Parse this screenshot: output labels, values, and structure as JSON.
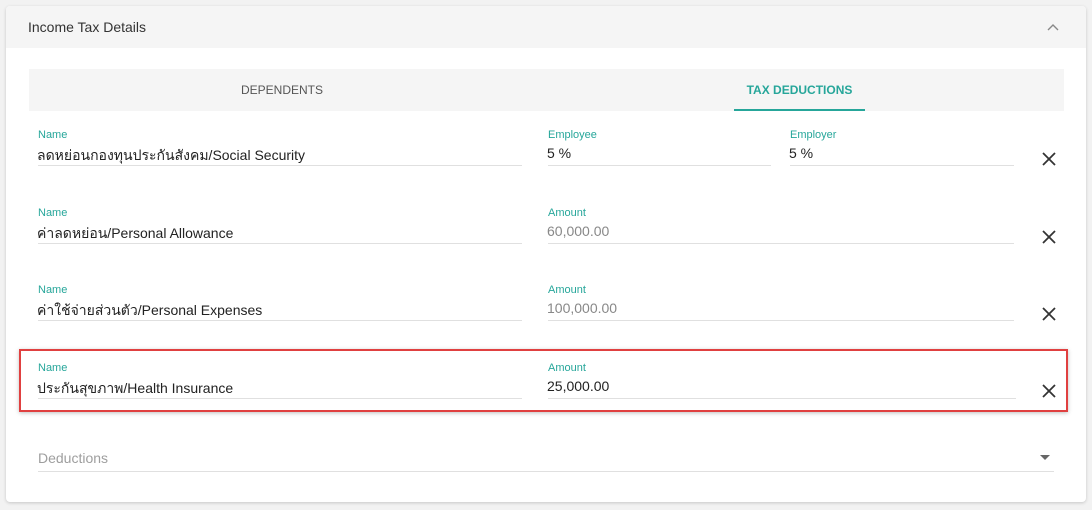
{
  "panel": {
    "title": "Income Tax Details"
  },
  "tabs": [
    {
      "label": "DEPENDENTS",
      "active": false
    },
    {
      "label": "TAX DEDUCTIONS",
      "active": true
    }
  ],
  "deductions": [
    {
      "name_label": "Name",
      "name": "ลดหย่อนกองทุนประกันสังคม/Social Security",
      "employee_label": "Employee",
      "employee": "5 %",
      "employer_label": "Employer",
      "employer": "5 %"
    },
    {
      "name_label": "Name",
      "name": "ค่าลดหย่อน/Personal Allowance",
      "amount_label": "Amount",
      "amount": "60,000.00"
    },
    {
      "name_label": "Name",
      "name": "ค่าใช้จ่ายส่วนตัว/Personal Expenses",
      "amount_label": "Amount",
      "amount": "100,000.00"
    },
    {
      "name_label": "Name",
      "name": "ประกันสุขภาพ/Health Insurance",
      "amount_label": "Amount",
      "amount": "25,000.00"
    }
  ],
  "deductions_select": {
    "placeholder": "Deductions"
  },
  "colors": {
    "accent": "#26a69a",
    "highlight": "#e04040"
  }
}
